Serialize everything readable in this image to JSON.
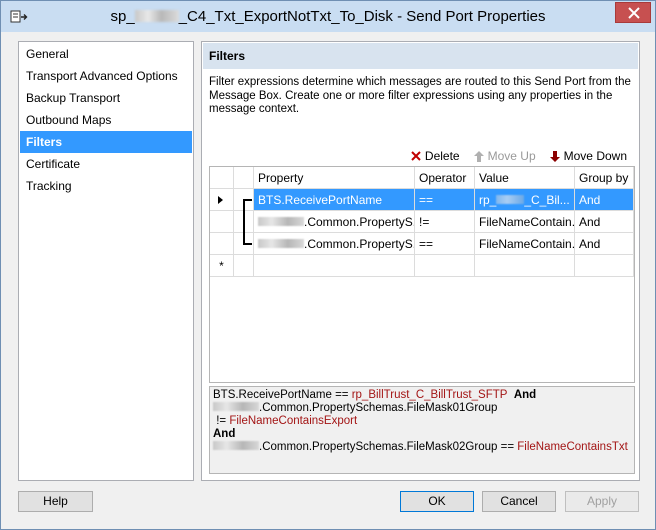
{
  "window": {
    "title_prefix": "sp_",
    "title_suffix": "_C4_Txt_ExportNotTxt_To_Disk - Send Port Properties"
  },
  "nav": {
    "items": [
      {
        "label": "General"
      },
      {
        "label": "Transport Advanced Options"
      },
      {
        "label": "Backup Transport"
      },
      {
        "label": "Outbound Maps"
      },
      {
        "label": "Filters"
      },
      {
        "label": "Certificate"
      },
      {
        "label": "Tracking"
      }
    ],
    "selected": "Filters"
  },
  "panel": {
    "title": "Filters",
    "description": "Filter expressions determine which messages are routed to this Send Port from the Message Box. Create one or more filter expressions using any properties in the message context."
  },
  "toolbar": {
    "delete": "Delete",
    "move_up": "Move Up",
    "move_down": "Move Down"
  },
  "grid": {
    "columns": [
      "Property",
      "Operator",
      "Value",
      "Group by"
    ],
    "rows": [
      {
        "property": "BTS.ReceivePortName",
        "operator": "==",
        "value_prefix": "rp_",
        "value_suffix": "_C_Bil...",
        "group_by": "And"
      },
      {
        "property_suffix": ".Common.PropertyS...",
        "operator": "!=",
        "value": "FileNameContain...",
        "group_by": "And"
      },
      {
        "property_suffix": ".Common.PropertyS...",
        "operator": "==",
        "value": "FileNameContain...",
        "group_by": "And"
      }
    ],
    "new_row_marker": "*"
  },
  "summary": {
    "line1_prop": "BTS.ReceivePortName",
    "line1_op": " == ",
    "line1_val": "rp_BillTrust_C_BillTrust_SFTP",
    "line1_kw": "And",
    "line2_prop": ".Common.PropertySchemas.FileMask01Group",
    "line2_op": " != ",
    "line2_val": "FileNameContainsExport",
    "line3_kw": "And",
    "line4_prop": ".Common.PropertySchemas.FileMask02Group",
    "line4_op": " == ",
    "line4_val": "FileNameContainsTxt"
  },
  "buttons": {
    "help": "Help",
    "ok": "OK",
    "cancel": "Cancel",
    "apply": "Apply"
  },
  "colors": {
    "selection": "#3399ff",
    "value_text": "#a31515",
    "close_button": "#c75050"
  }
}
